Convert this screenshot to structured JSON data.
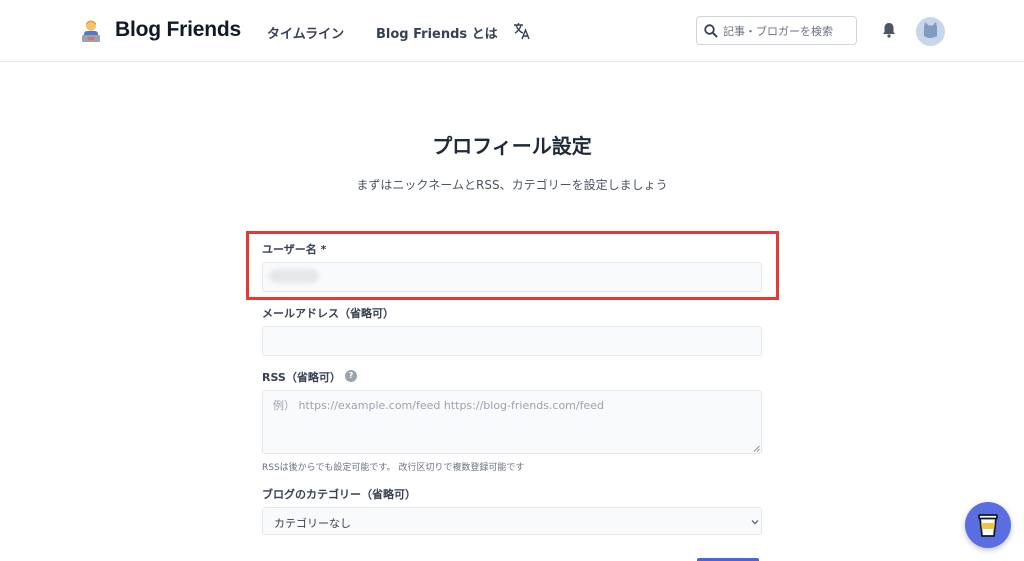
{
  "header": {
    "brand": "Blog Friends",
    "nav": {
      "timeline": "タイムライン",
      "about": "Blog Friends とは"
    },
    "search": {
      "placeholder": "記事・ブロガーを検索"
    }
  },
  "main": {
    "title": "プロフィール設定",
    "subtitle": "まずはニックネームとRSS、カテゴリーを設定しましょう"
  },
  "form": {
    "username": {
      "label": "ユーザー名 *",
      "value": ""
    },
    "email": {
      "label": "メールアドレス（省略可）",
      "value": ""
    },
    "rss": {
      "label": "RSS（省略可）",
      "placeholder": "例） https://example.com/feed https://blog-friends.com/feed",
      "hint": "RSSは後からでも設定可能です。 改行区切りで複数登録可能です"
    },
    "category": {
      "label": "ブログのカテゴリー（省略可）",
      "selected": "カテゴリーなし"
    }
  },
  "colors": {
    "highlight": "#e53935",
    "accent": "#5b6ee1"
  },
  "icons": {
    "logo": "person-laptop-icon",
    "translate": "translate-icon",
    "search": "search-icon",
    "notification": "bell-icon",
    "avatar": "cat-avatar-icon",
    "help": "question-circle-icon",
    "dropdown": "chevron-down-icon",
    "floating": "coffee-cup-icon"
  }
}
